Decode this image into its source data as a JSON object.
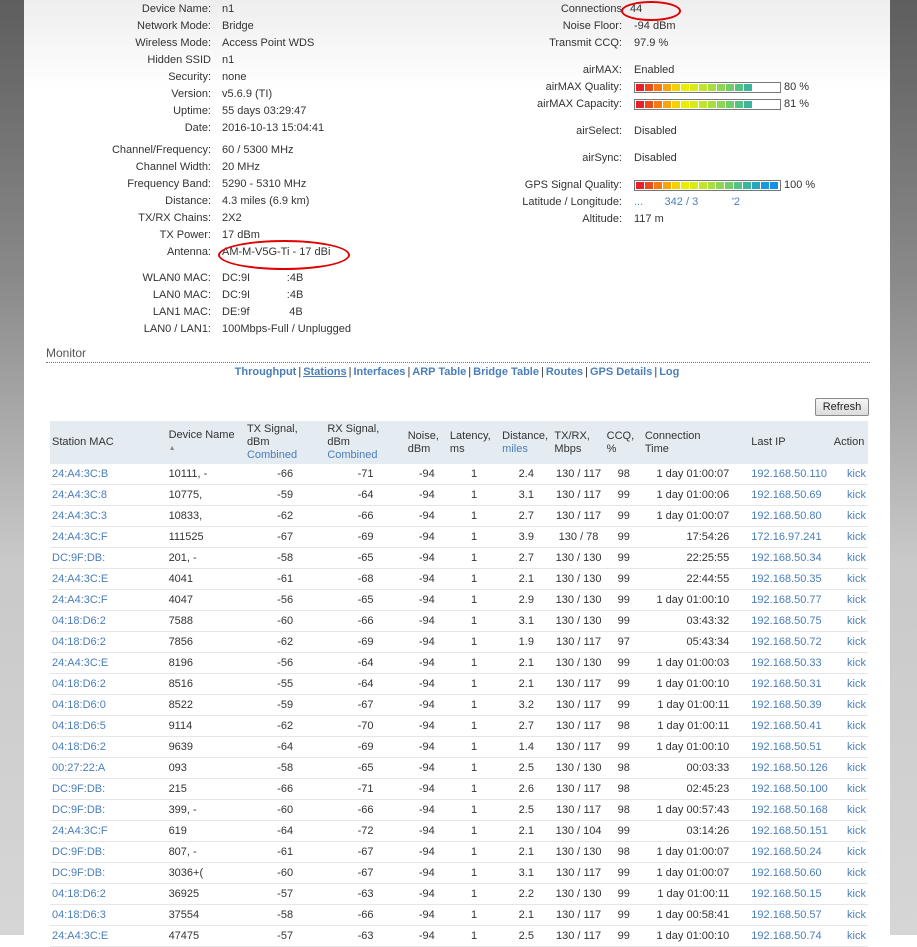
{
  "device_info": [
    {
      "label": "Device Name:",
      "value": "n1"
    },
    {
      "label": "Network Mode:",
      "value": "Bridge"
    },
    {
      "label": "Wireless Mode:",
      "value": "Access Point WDS"
    },
    {
      "label": "Hidden SSID",
      "value": "n1"
    },
    {
      "label": "Security:",
      "value": "none"
    },
    {
      "label": "Version:",
      "value": "v5.6.9 (TI)"
    },
    {
      "label": "Uptime:",
      "value": "55 days 03:29:47"
    },
    {
      "label": "Date:",
      "value": "2016-10-13 15:04:41"
    }
  ],
  "radio_info": [
    {
      "label": "Channel/Frequency:",
      "value": "60 / 5300 MHz"
    },
    {
      "label": "Channel Width:",
      "value": "20 MHz"
    },
    {
      "label": "Frequency Band:",
      "value": "5290 - 5310 MHz"
    },
    {
      "label": "Distance:",
      "value": "4.3 miles (6.9 km)"
    },
    {
      "label": "TX/RX Chains:",
      "value": "2X2"
    },
    {
      "label": "TX Power:",
      "value": "17 dBm"
    },
    {
      "label": "Antenna:",
      "value": "AM-M-V5G-Ti - 17 dBi"
    },
    {
      "label": "WLAN0 MAC:",
      "value": "DC:9I            :4B"
    },
    {
      "label": "LAN0 MAC:",
      "value": "DC:9I            :4B"
    },
    {
      "label": "LAN1 MAC:",
      "value": "DE:9f             4B"
    },
    {
      "label": "LAN0 / LAN1:",
      "value": "100Mbps-Full / Unplugged"
    }
  ],
  "status_info": {
    "connections": {
      "label": "Connections",
      "value": "44"
    },
    "noise_floor": {
      "label": "Noise Floor:",
      "value": "-94 dBm"
    },
    "transmit_ccq": {
      "label": "Transmit CCQ:",
      "value": "97.9 %"
    },
    "airmax": {
      "label": "airMAX:",
      "value": "Enabled"
    },
    "airmax_quality": {
      "label": "airMAX Quality:",
      "percent": 80,
      "text": "80 %"
    },
    "airmax_capacity": {
      "label": "airMAX Capacity:",
      "percent": 81,
      "text": "81 %"
    },
    "airselect": {
      "label": "airSelect:",
      "value": "Disabled"
    },
    "airsync": {
      "label": "airSync:",
      "value": "Disabled"
    },
    "gps_quality": {
      "label": "GPS Signal Quality:",
      "percent": 100,
      "text": "100 %"
    },
    "lat_long": {
      "label": "Latitude / Longitude:",
      "value": "...       342 / 3           '2"
    },
    "altitude": {
      "label": "Altitude:",
      "value": "117 m"
    }
  },
  "bar_colors": [
    "#e8202a",
    "#ef4a1c",
    "#f47a12",
    "#f9a60b",
    "#f7d000",
    "#eded00",
    "#d6ec14",
    "#bfe62a",
    "#a6df3e",
    "#8cd653",
    "#72cc6a",
    "#55c183",
    "#3bb59e",
    "#27a6bf",
    "#1b99dc",
    "#1590e8"
  ],
  "monitor": {
    "title": "Monitor",
    "tabs": [
      {
        "label": "Throughput",
        "active": false
      },
      {
        "label": "Stations",
        "active": true
      },
      {
        "label": "Interfaces",
        "active": false
      },
      {
        "label": "ARP Table",
        "active": false
      },
      {
        "label": "Bridge Table",
        "active": false
      },
      {
        "label": "Routes",
        "active": false
      },
      {
        "label": "GPS Details",
        "active": false
      },
      {
        "label": "Log",
        "active": false
      }
    ],
    "refresh_label": "Refresh"
  },
  "table": {
    "headers": {
      "mac": "Station MAC",
      "name": "Device Name",
      "tx": "TX Signal, dBm",
      "tx_sub": "Combined",
      "rx": "RX Signal, dBm",
      "rx_sub": "Combined",
      "noise": "Noise,",
      "noise_sub": "dBm",
      "latency": "Latency,",
      "latency_sub": "ms",
      "distance": "Distance,",
      "distance_sub": "miles",
      "rate": "TX/RX,",
      "rate_sub": "Mbps",
      "ccq": "CCQ,",
      "ccq_sub": "%",
      "time": "Connection",
      "time_sub": "Time",
      "ip": "Last IP",
      "action": "Action"
    },
    "rows": [
      {
        "mac": "24:A4:3C:B",
        "name": "10111, -",
        "tx": "-66",
        "rx": "-71",
        "noise": "-94",
        "latency": "1",
        "distance": "2.4",
        "rate": "130 / 117",
        "ccq": "98",
        "time": "1 day 01:00:07",
        "ip": "192.168.50.110",
        "action": "kick"
      },
      {
        "mac": "24:A4:3C:8",
        "name": "10775,",
        "tx": "-59",
        "rx": "-64",
        "noise": "-94",
        "latency": "1",
        "distance": "3.1",
        "rate": "130 / 117",
        "ccq": "99",
        "time": "1 day 01:00:06",
        "ip": "192.168.50.69",
        "action": "kick"
      },
      {
        "mac": "24:A4:3C:3",
        "name": "10833,",
        "tx": "-62",
        "rx": "-66",
        "noise": "-94",
        "latency": "1",
        "distance": "2.7",
        "rate": "130 / 117",
        "ccq": "99",
        "time": "1 day 01:00:07",
        "ip": "192.168.50.80",
        "action": "kick"
      },
      {
        "mac": "24:A4:3C:F",
        "name": "111525",
        "tx": "-67",
        "rx": "-69",
        "noise": "-94",
        "latency": "1",
        "distance": "3.9",
        "rate": "130 / 78",
        "ccq": "99",
        "time": "17:54:26",
        "ip": "172.16.97.241",
        "action": "kick"
      },
      {
        "mac": "DC:9F:DB:",
        "name": "201, -",
        "tx": "-58",
        "rx": "-65",
        "noise": "-94",
        "latency": "1",
        "distance": "2.7",
        "rate": "130 / 130",
        "ccq": "99",
        "time": "22:25:55",
        "ip": "192.168.50.34",
        "action": "kick"
      },
      {
        "mac": "24:A4:3C:E",
        "name": "4041",
        "tx": "-61",
        "rx": "-68",
        "noise": "-94",
        "latency": "1",
        "distance": "2.1",
        "rate": "130 / 130",
        "ccq": "99",
        "time": "22:44:55",
        "ip": "192.168.50.35",
        "action": "kick"
      },
      {
        "mac": "24:A4:3C:F",
        "name": "4047",
        "tx": "-56",
        "rx": "-65",
        "noise": "-94",
        "latency": "1",
        "distance": "2.9",
        "rate": "130 / 130",
        "ccq": "99",
        "time": "1 day 01:00:10",
        "ip": "192.168.50.77",
        "action": "kick"
      },
      {
        "mac": "04:18:D6:2",
        "name": "7588",
        "tx": "-60",
        "rx": "-66",
        "noise": "-94",
        "latency": "1",
        "distance": "3.1",
        "rate": "130 / 130",
        "ccq": "99",
        "time": "03:43:32",
        "ip": "192.168.50.75",
        "action": "kick"
      },
      {
        "mac": "04:18:D6:2",
        "name": "7856",
        "tx": "-62",
        "rx": "-69",
        "noise": "-94",
        "latency": "1",
        "distance": "1.9",
        "rate": "130 / 117",
        "ccq": "97",
        "time": "05:43:34",
        "ip": "192.168.50.72",
        "action": "kick"
      },
      {
        "mac": "24:A4:3C:E",
        "name": "8196",
        "tx": "-56",
        "rx": "-64",
        "noise": "-94",
        "latency": "1",
        "distance": "2.1",
        "rate": "130 / 130",
        "ccq": "99",
        "time": "1 day 01:00:03",
        "ip": "192.168.50.33",
        "action": "kick"
      },
      {
        "mac": "04:18:D6:2",
        "name": "8516",
        "tx": "-55",
        "rx": "-64",
        "noise": "-94",
        "latency": "1",
        "distance": "2.1",
        "rate": "130 / 117",
        "ccq": "99",
        "time": "1 day 01:00:10",
        "ip": "192.168.50.31",
        "action": "kick"
      },
      {
        "mac": "04:18:D6:0",
        "name": "8522",
        "tx": "-59",
        "rx": "-67",
        "noise": "-94",
        "latency": "1",
        "distance": "3.2",
        "rate": "130 / 117",
        "ccq": "99",
        "time": "1 day 01:00:11",
        "ip": "192.168.50.39",
        "action": "kick"
      },
      {
        "mac": "04:18:D6:5",
        "name": "9114",
        "tx": "-62",
        "rx": "-70",
        "noise": "-94",
        "latency": "1",
        "distance": "2.7",
        "rate": "130 / 117",
        "ccq": "98",
        "time": "1 day 01:00:11",
        "ip": "192.168.50.41",
        "action": "kick"
      },
      {
        "mac": "04:18:D6:2",
        "name": "9639",
        "tx": "-64",
        "rx": "-69",
        "noise": "-94",
        "latency": "1",
        "distance": "1.4",
        "rate": "130 / 117",
        "ccq": "99",
        "time": "1 day 01:00:10",
        "ip": "192.168.50.51",
        "action": "kick"
      },
      {
        "mac": "00:27:22:A",
        "name": "093",
        "tx": "-58",
        "rx": "-65",
        "noise": "-94",
        "latency": "1",
        "distance": "2.5",
        "rate": "130 / 130",
        "ccq": "98",
        "time": "00:03:33",
        "ip": "192.168.50.126",
        "action": "kick"
      },
      {
        "mac": "DC:9F:DB:",
        "name": "215",
        "tx": "-66",
        "rx": "-71",
        "noise": "-94",
        "latency": "1",
        "distance": "2.6",
        "rate": "130 / 117",
        "ccq": "98",
        "time": "02:45:23",
        "ip": "192.168.50.100",
        "action": "kick"
      },
      {
        "mac": "DC:9F:DB:",
        "name": "399, -",
        "tx": "-60",
        "rx": "-66",
        "noise": "-94",
        "latency": "1",
        "distance": "2.5",
        "rate": "130 / 117",
        "ccq": "98",
        "time": "1 day 00:57:43",
        "ip": "192.168.50.168",
        "action": "kick"
      },
      {
        "mac": "24:A4:3C:F",
        "name": "619",
        "tx": "-64",
        "rx": "-72",
        "noise": "-94",
        "latency": "1",
        "distance": "2.1",
        "rate": "130 / 104",
        "ccq": "99",
        "time": "03:14:26",
        "ip": "192.168.50.151",
        "action": "kick"
      },
      {
        "mac": "DC:9F:DB:",
        "name": "807, -",
        "tx": "-61",
        "rx": "-67",
        "noise": "-94",
        "latency": "1",
        "distance": "2.1",
        "rate": "130 / 130",
        "ccq": "98",
        "time": "1 day 01:00:07",
        "ip": "192.168.50.24",
        "action": "kick"
      },
      {
        "mac": "DC:9F:DB:",
        "name": "3036+(",
        "tx": "-60",
        "rx": "-67",
        "noise": "-94",
        "latency": "1",
        "distance": "3.1",
        "rate": "130 / 117",
        "ccq": "99",
        "time": "1 day 01:00:07",
        "ip": "192.168.50.60",
        "action": "kick"
      },
      {
        "mac": "04:18:D6:2",
        "name": "36925",
        "tx": "-57",
        "rx": "-63",
        "noise": "-94",
        "latency": "1",
        "distance": "2.2",
        "rate": "130 / 130",
        "ccq": "99",
        "time": "1 day 01:00:11",
        "ip": "192.168.50.15",
        "action": "kick"
      },
      {
        "mac": "04:18:D6:3",
        "name": "37554",
        "tx": "-58",
        "rx": "-66",
        "noise": "-94",
        "latency": "1",
        "distance": "2.1",
        "rate": "130 / 117",
        "ccq": "99",
        "time": "1 day 00:58:41",
        "ip": "192.168.50.57",
        "action": "kick"
      },
      {
        "mac": "24:A4:3C:E",
        "name": "47475",
        "tx": "-57",
        "rx": "-63",
        "noise": "-94",
        "latency": "1",
        "distance": "2.5",
        "rate": "130 / 117",
        "ccq": "99",
        "time": "1 day 01:00:10",
        "ip": "192.168.50.74",
        "action": "kick"
      }
    ]
  }
}
